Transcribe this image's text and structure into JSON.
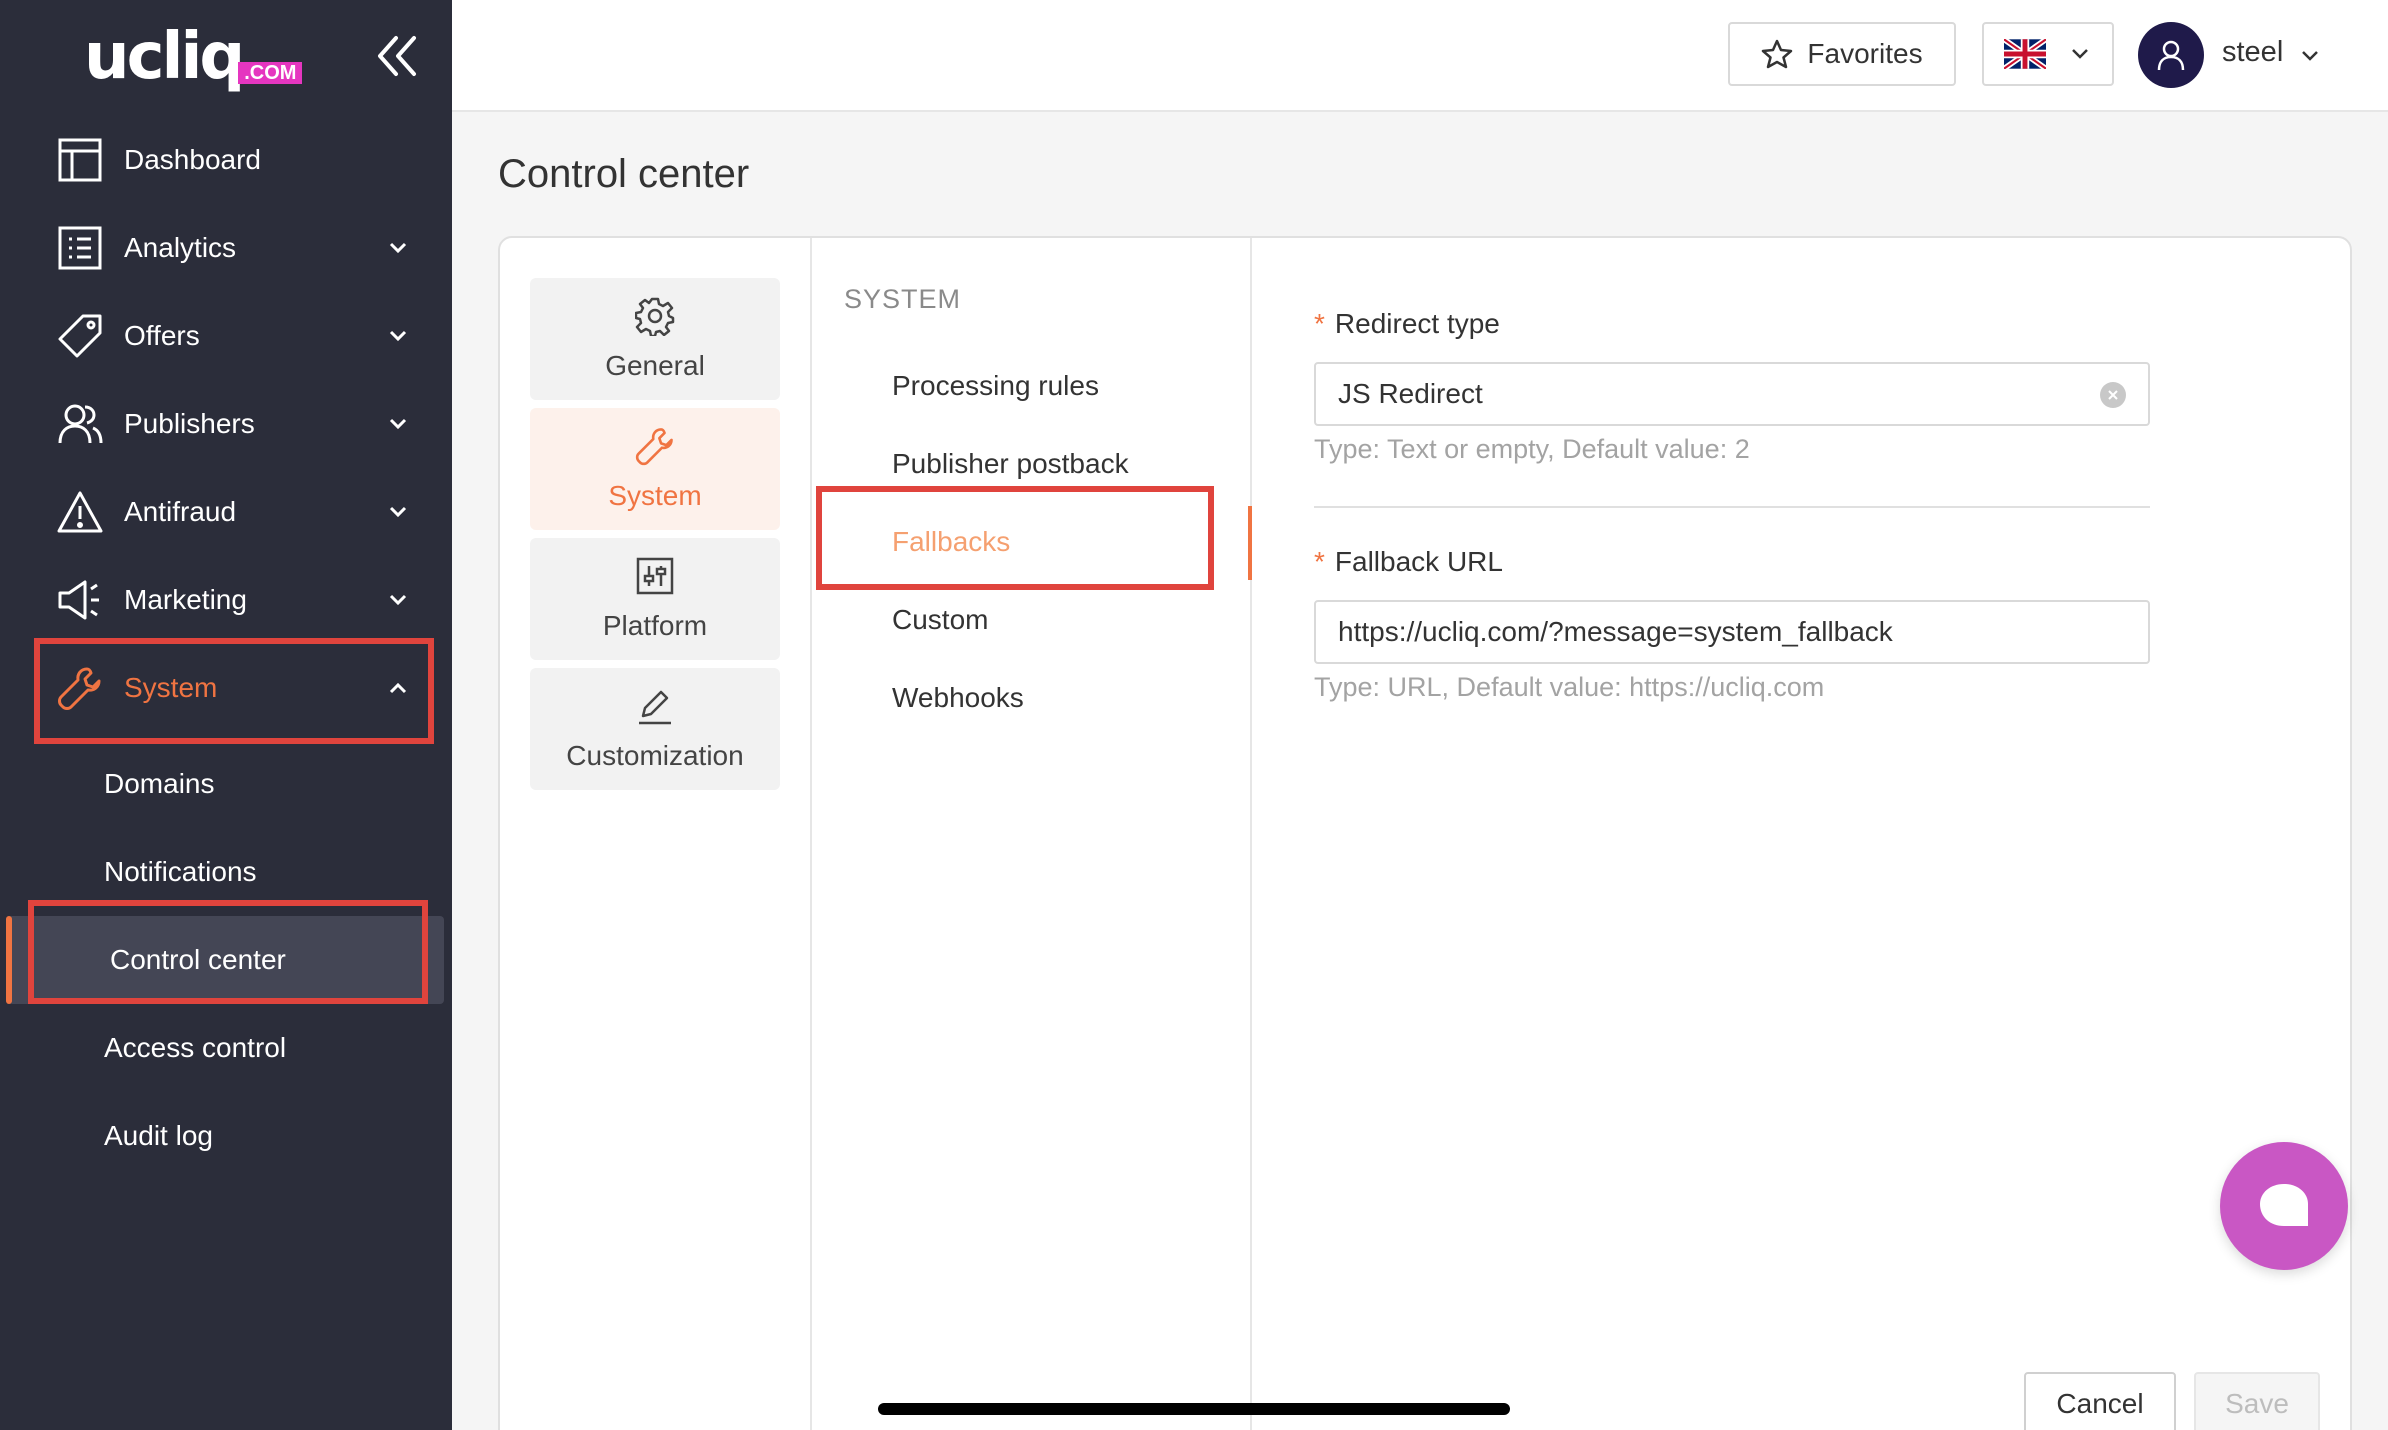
{
  "brand": {
    "logo_text": "ucliq",
    "logo_suffix": ".COM"
  },
  "sidebar": {
    "items": [
      {
        "label": "Dashboard",
        "icon": "layout-icon"
      },
      {
        "label": "Analytics",
        "icon": "list-icon"
      },
      {
        "label": "Offers",
        "icon": "tag-icon"
      },
      {
        "label": "Publishers",
        "icon": "users-icon"
      },
      {
        "label": "Antifraud",
        "icon": "warning-icon"
      },
      {
        "label": "Marketing",
        "icon": "megaphone-icon"
      },
      {
        "label": "System",
        "icon": "wrench-icon"
      }
    ],
    "system_sub": [
      "Domains",
      "Notifications",
      "Control center",
      "Access control",
      "Audit log"
    ]
  },
  "header": {
    "favorites_label": "Favorites",
    "language_flag": "uk-flag-icon",
    "user_name": "steel"
  },
  "page": {
    "title": "Control center"
  },
  "categories": [
    "General",
    "System",
    "Platform",
    "Customization"
  ],
  "system_menu": {
    "heading": "SYSTEM",
    "items": [
      "Processing rules",
      "Publisher postback",
      "Fallbacks",
      "Custom",
      "Webhooks"
    ]
  },
  "form": {
    "redirect_type": {
      "label": "Redirect type",
      "value": "JS Redirect",
      "help": "Type: Text or empty,  Default value: 2"
    },
    "fallback_url": {
      "label": "Fallback URL",
      "value": "https://ucliq.com/?message=system_fallback",
      "help": "Type: URL,  Default value: https://ucliq.com"
    },
    "required_mark": "*"
  },
  "actions": {
    "cancel": "Cancel",
    "save": "Save"
  },
  "colors": {
    "accent": "#f07442",
    "sidebar_bg": "#2b2d3a",
    "highlight": "#e0443d",
    "chat": "#c957c4"
  }
}
